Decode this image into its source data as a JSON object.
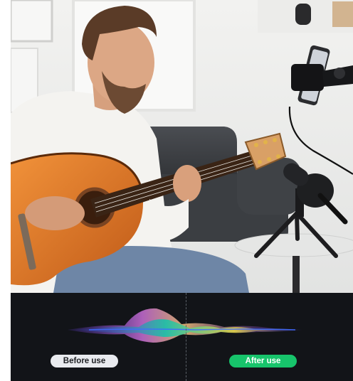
{
  "comparison": {
    "before_label": "Before use",
    "after_label": "After use"
  },
  "colors": {
    "panel_bg": "#121418",
    "after_accent": "#17c46b",
    "before_pill": "#e9ebef"
  },
  "photo": {
    "subject": "man-playing-guitar",
    "props": [
      "acoustic-guitar",
      "phone-holder",
      "microphone",
      "tripod",
      "sofa",
      "side-table"
    ]
  }
}
